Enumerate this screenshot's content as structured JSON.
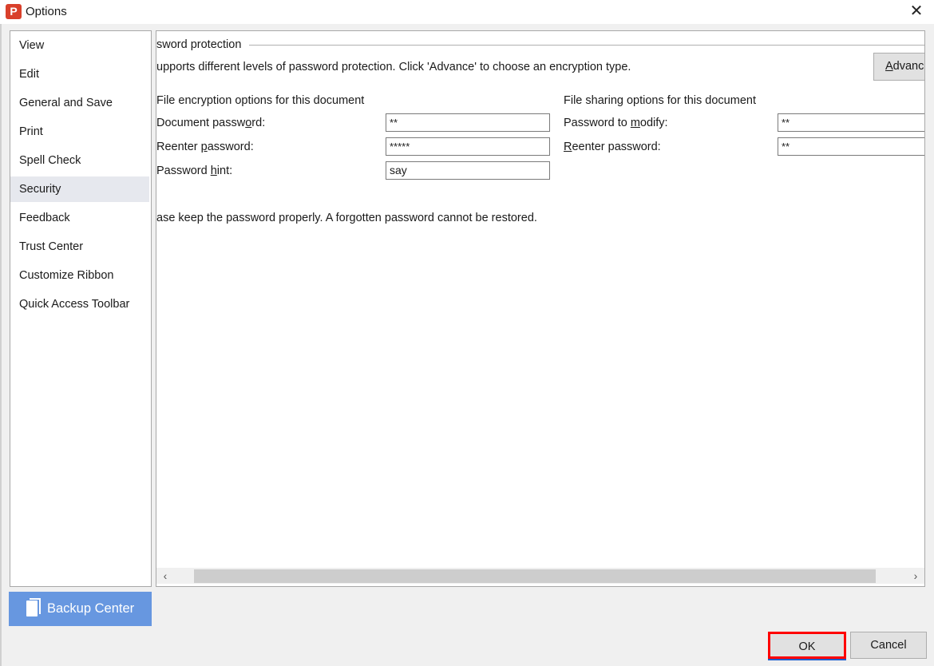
{
  "window": {
    "title": "Options",
    "app_icon_letter": "P",
    "close_icon": "close-icon"
  },
  "sidebar": {
    "items": [
      {
        "label": "View"
      },
      {
        "label": "Edit"
      },
      {
        "label": "General and Save"
      },
      {
        "label": "Print"
      },
      {
        "label": "Spell Check"
      },
      {
        "label": "Security",
        "selected": true
      },
      {
        "label": "Feedback"
      },
      {
        "label": "Trust Center"
      },
      {
        "label": "Customize Ribbon"
      },
      {
        "label": "Quick Access Toolbar"
      }
    ]
  },
  "backup": {
    "label": "Backup Center",
    "icon": "backup-icon",
    "color": "#6797e0"
  },
  "security": {
    "group_title": "sword protection",
    "description": "upports different levels of password protection. Click 'Advance' to choose an encryption type.",
    "advance": {
      "pre": "",
      "key": "A",
      "post": "dvanc"
    },
    "encryption": {
      "title": "File encryption options for this document",
      "document_password": {
        "pre": "Document passw",
        "key": "o",
        "post": "rd:",
        "value": "**"
      },
      "reenter_password": {
        "pre": "Reenter ",
        "key": "p",
        "post": "assword:",
        "value": "*****"
      },
      "password_hint": {
        "pre": "Password ",
        "key": "h",
        "post": "int:",
        "value": "say"
      }
    },
    "sharing": {
      "title": "File sharing options for this document",
      "password_to_modify": {
        "pre": "Password to ",
        "key": "m",
        "post": "odify:",
        "value": "**"
      },
      "reenter_password": {
        "pre": "",
        "key": "R",
        "post": "eenter password:",
        "value": "**"
      }
    },
    "warning": "ase keep the password properly. A forgotten password cannot be restored."
  },
  "footer": {
    "ok": "OK",
    "cancel": "Cancel",
    "highlight_color": "#ff0000"
  }
}
